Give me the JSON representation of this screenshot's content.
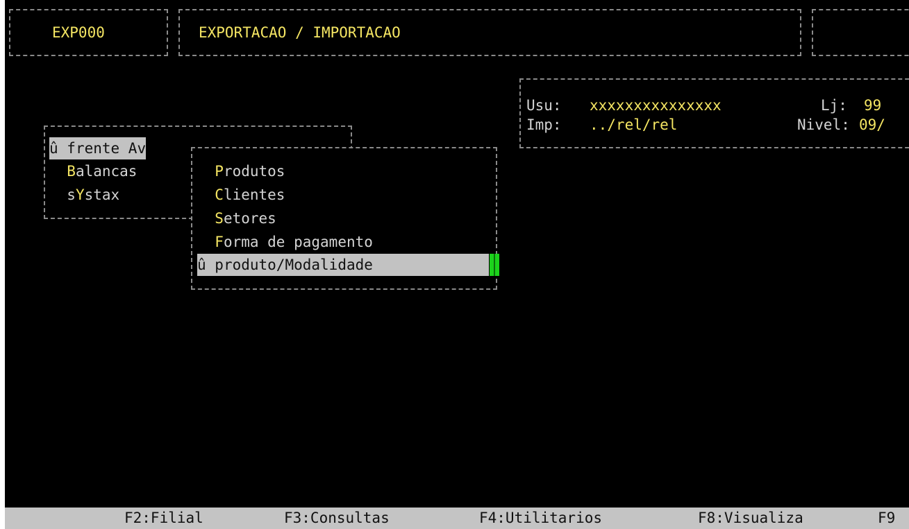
{
  "header": {
    "program_code": "EXP000",
    "program_title": "EXPORTACAO / IMPORTACAO"
  },
  "info_panel": {
    "user_label": "Usu:",
    "user_value": "xxxxxxxxxxxxxxx",
    "store_label": "Lj:",
    "store_value": "99",
    "printer_label": "Imp:",
    "printer_value": "../rel/rel",
    "level_label": "Nivel:",
    "level_value": "09/"
  },
  "main_menu": {
    "items": [
      {
        "marker": "û ",
        "hotkey": "f",
        "rest": "rente Av",
        "selected": true
      },
      {
        "marker": "  ",
        "hotkey": "B",
        "rest": "alancas",
        "selected": false
      },
      {
        "marker": "  ",
        "prefix": "s",
        "hotkey": "Y",
        "rest": "stax",
        "selected": false
      }
    ]
  },
  "submenu": {
    "items": [
      {
        "marker": "  ",
        "hotkey": "P",
        "rest": "rodutos",
        "selected": false
      },
      {
        "marker": "  ",
        "hotkey": "C",
        "rest": "lientes",
        "selected": false
      },
      {
        "marker": "  ",
        "hotkey": "S",
        "rest": "etores",
        "selected": false
      },
      {
        "marker": "  ",
        "hotkey": "F",
        "rest": "orma de pagamento",
        "selected": false
      },
      {
        "marker": "û ",
        "hotkey": "p",
        "rest": "roduto/Modalidade",
        "selected": true
      }
    ]
  },
  "footer": {
    "keys": [
      {
        "label": "F2:Filial"
      },
      {
        "label": "F3:Consultas"
      },
      {
        "label": "F4:Utilitarios"
      },
      {
        "label": "F8:Visualiza"
      },
      {
        "label": "F9"
      }
    ]
  },
  "colors": {
    "background": "#000000",
    "text": "#d4d4d4",
    "highlight_text": "#f5e663",
    "selection_bar": "#c2c2c2",
    "cursor": "#1cd21c",
    "footer_bar": "#c4c4c4"
  }
}
